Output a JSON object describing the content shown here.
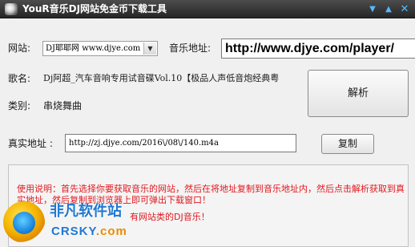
{
  "window": {
    "title": "YouR音乐DJ网站免金币下载工具"
  },
  "site": {
    "label": "网站:",
    "selected": "DJ耶耶网 www.djye.com"
  },
  "music_url": {
    "label": "音乐地址:",
    "value": "http://www.djye.com/player/"
  },
  "song": {
    "label": "歌名:",
    "value": "Dj阿超_汽车音响专用试音碟Vol.10【极品人声低音炮经典粤"
  },
  "category": {
    "label": "类别:",
    "value": "串烧舞曲"
  },
  "parse_button": "解析",
  "real_url": {
    "label": "真实地址 :",
    "value": "http://zj.djye.com/2016\\/08\\/140.m4a"
  },
  "copy_button": "复制",
  "instructions": {
    "line1": "使用说明：首先选择你要获取音乐的网站，然后在将地址复制到音乐地址内，然后点击解析获取到真实地址，然后复制到浏览器上即可弹出下载窗口！",
    "line2": "有网站类的DJ音乐！"
  },
  "watermark": {
    "cn": "非凡软件站",
    "en_main": "CRSKY",
    "en_suffix": ".com"
  },
  "colors": {
    "titlebar": "#262626",
    "instruction_text": "#e0191f",
    "watermark": "#1f78d1"
  }
}
